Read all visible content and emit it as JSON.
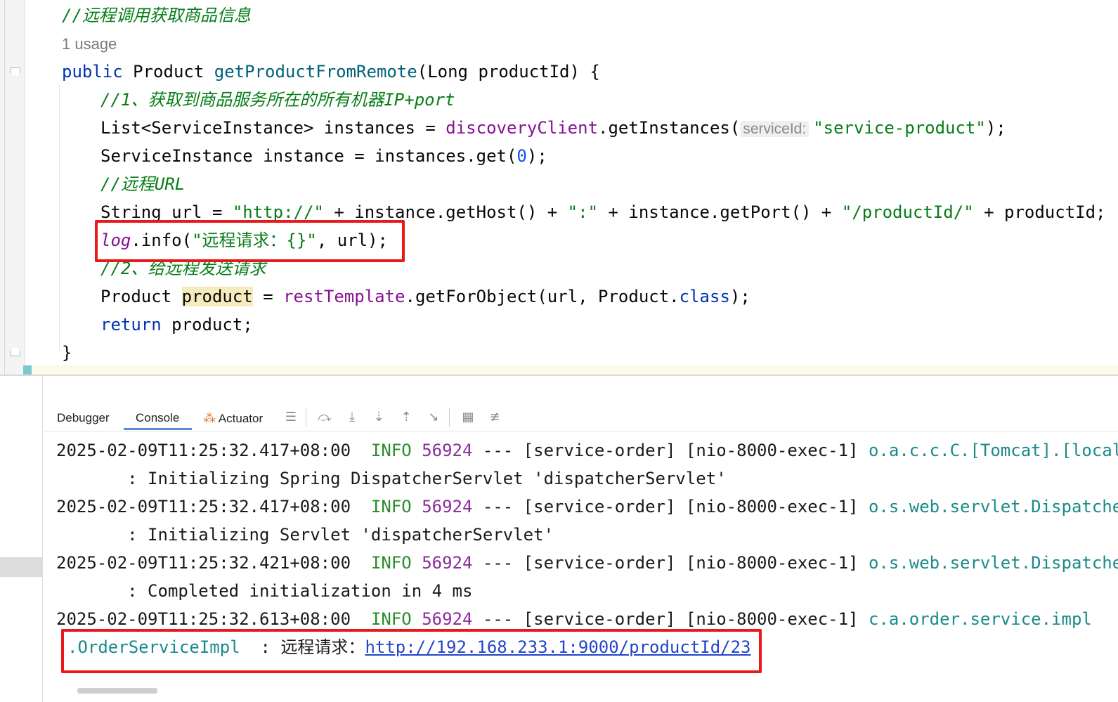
{
  "editor": {
    "comment_top": "//远程调用获取商品信息",
    "usage": "1 usage",
    "sig": {
      "kw": "public",
      "type": "Product",
      "method": "getProductFromRemote",
      "params": "(Long productId) {"
    },
    "c1": "//1、获取到商品服务所在的所有机器IP+port",
    "l_list_a": "List<ServiceInstance> instances = ",
    "l_list_field": "discoveryClient",
    "l_list_b": ".getInstances(",
    "l_list_hint": "serviceId:",
    "l_list_str": "\"service-product\"",
    "l_list_end": ");",
    "l_inst_a": "ServiceInstance instance = instances.get(",
    "l_inst_num": "0",
    "l_inst_end": ");",
    "c2": "//远程URL",
    "l_url_a": "String url = ",
    "l_url_s1": "\"http://\"",
    "l_url_b": " + instance.getHost() + ",
    "l_url_s2": "\":\"",
    "l_url_c": " + instance.getPort() + ",
    "l_url_s3": "\"/productId/\"",
    "l_url_d": " + productId;",
    "l_log_field": "log",
    "l_log_a": ".info(",
    "l_log_str": "\"远程请求：{}\"",
    "l_log_end": ", url);",
    "c3": "//2、给远程发送请求",
    "l_prod_a": "Product ",
    "l_prod_var": "product",
    "l_prod_b": " = ",
    "l_prod_field": "restTemplate",
    "l_prod_c": ".getForObject(url, Product.",
    "l_prod_kw": "class",
    "l_prod_end": ");",
    "l_ret_kw": "return",
    "l_ret_rest": " product;",
    "close": "}"
  },
  "toolbar": {
    "tabs": [
      "Debugger",
      "Console",
      "Actuator"
    ],
    "active_tab": "Console"
  },
  "console": {
    "lines": [
      {
        "ts": "2025-02-09T11:25:32.417+08:00",
        "level": "INFO",
        "pid": "56924",
        "mid": " --- [service-order] [nio-8000-exec-1] ",
        "logger": "o.a.c.c.C.[Tomcat].[localhos",
        "msg": "       : Initializing Spring DispatcherServlet 'dispatcherServlet'"
      },
      {
        "ts": "2025-02-09T11:25:32.417+08:00",
        "level": "INFO",
        "pid": "56924",
        "mid": " --- [service-order] [nio-8000-exec-1] ",
        "logger": "o.s.web.servlet.DispatcherSe",
        "msg": "       : Initializing Servlet 'dispatcherServlet'"
      },
      {
        "ts": "2025-02-09T11:25:32.421+08:00",
        "level": "INFO",
        "pid": "56924",
        "mid": " --- [service-order] [nio-8000-exec-1] ",
        "logger": "o.s.web.servlet.DispatcherSe",
        "msg": "       : Completed initialization in 4 ms"
      },
      {
        "ts": "2025-02-09T11:25:32.613+08:00",
        "level": "INFO",
        "pid": "56924",
        "mid": " --- [service-order] [nio-8000-exec-1] ",
        "logger": "c.a.order.service.impl",
        "msg": ""
      }
    ],
    "last_logger_cont": ".OrderServiceImpl",
    "last_sep": "  : ",
    "last_msg_cn": "远程请求：",
    "last_url": "http://192.168.233.1:9000/productId/23"
  },
  "colors": {
    "highlight_box": "#e8191b",
    "link": "#2346c9"
  }
}
